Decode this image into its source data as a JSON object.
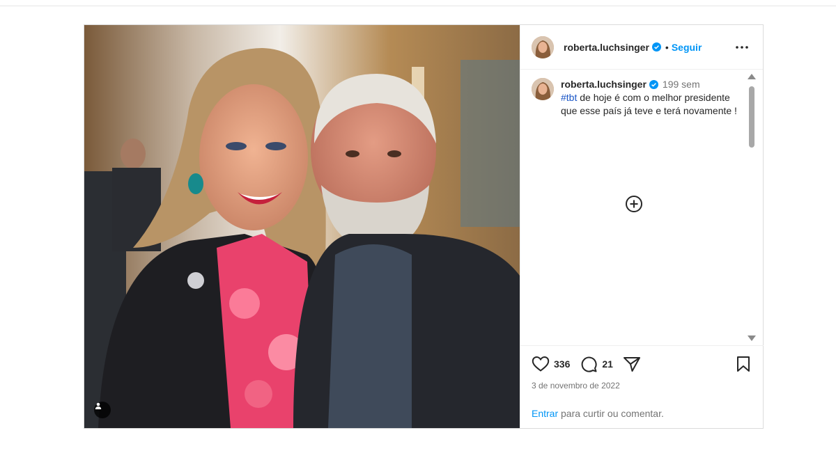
{
  "post": {
    "username": "roberta.luchsinger",
    "verified": true,
    "follow_label": "Seguir",
    "dot": "•",
    "more_icon": "ellipsis-icon"
  },
  "caption": {
    "username": "roberta.luchsinger",
    "time": "199 sem",
    "hashtag": "#tbt",
    "text": " de hoje é com o melhor presidente que esse país já teve e terá novamente !"
  },
  "actions": {
    "likes": "336",
    "comments": "21",
    "date": "3 de novembro de 2022"
  },
  "login": {
    "link": "Entrar",
    "text": " para curtir ou comentar."
  },
  "colors": {
    "accent": "#0095f6",
    "verified": "#0095f6",
    "text": "#262626",
    "muted": "#737373",
    "border": "#dbdbdb"
  }
}
